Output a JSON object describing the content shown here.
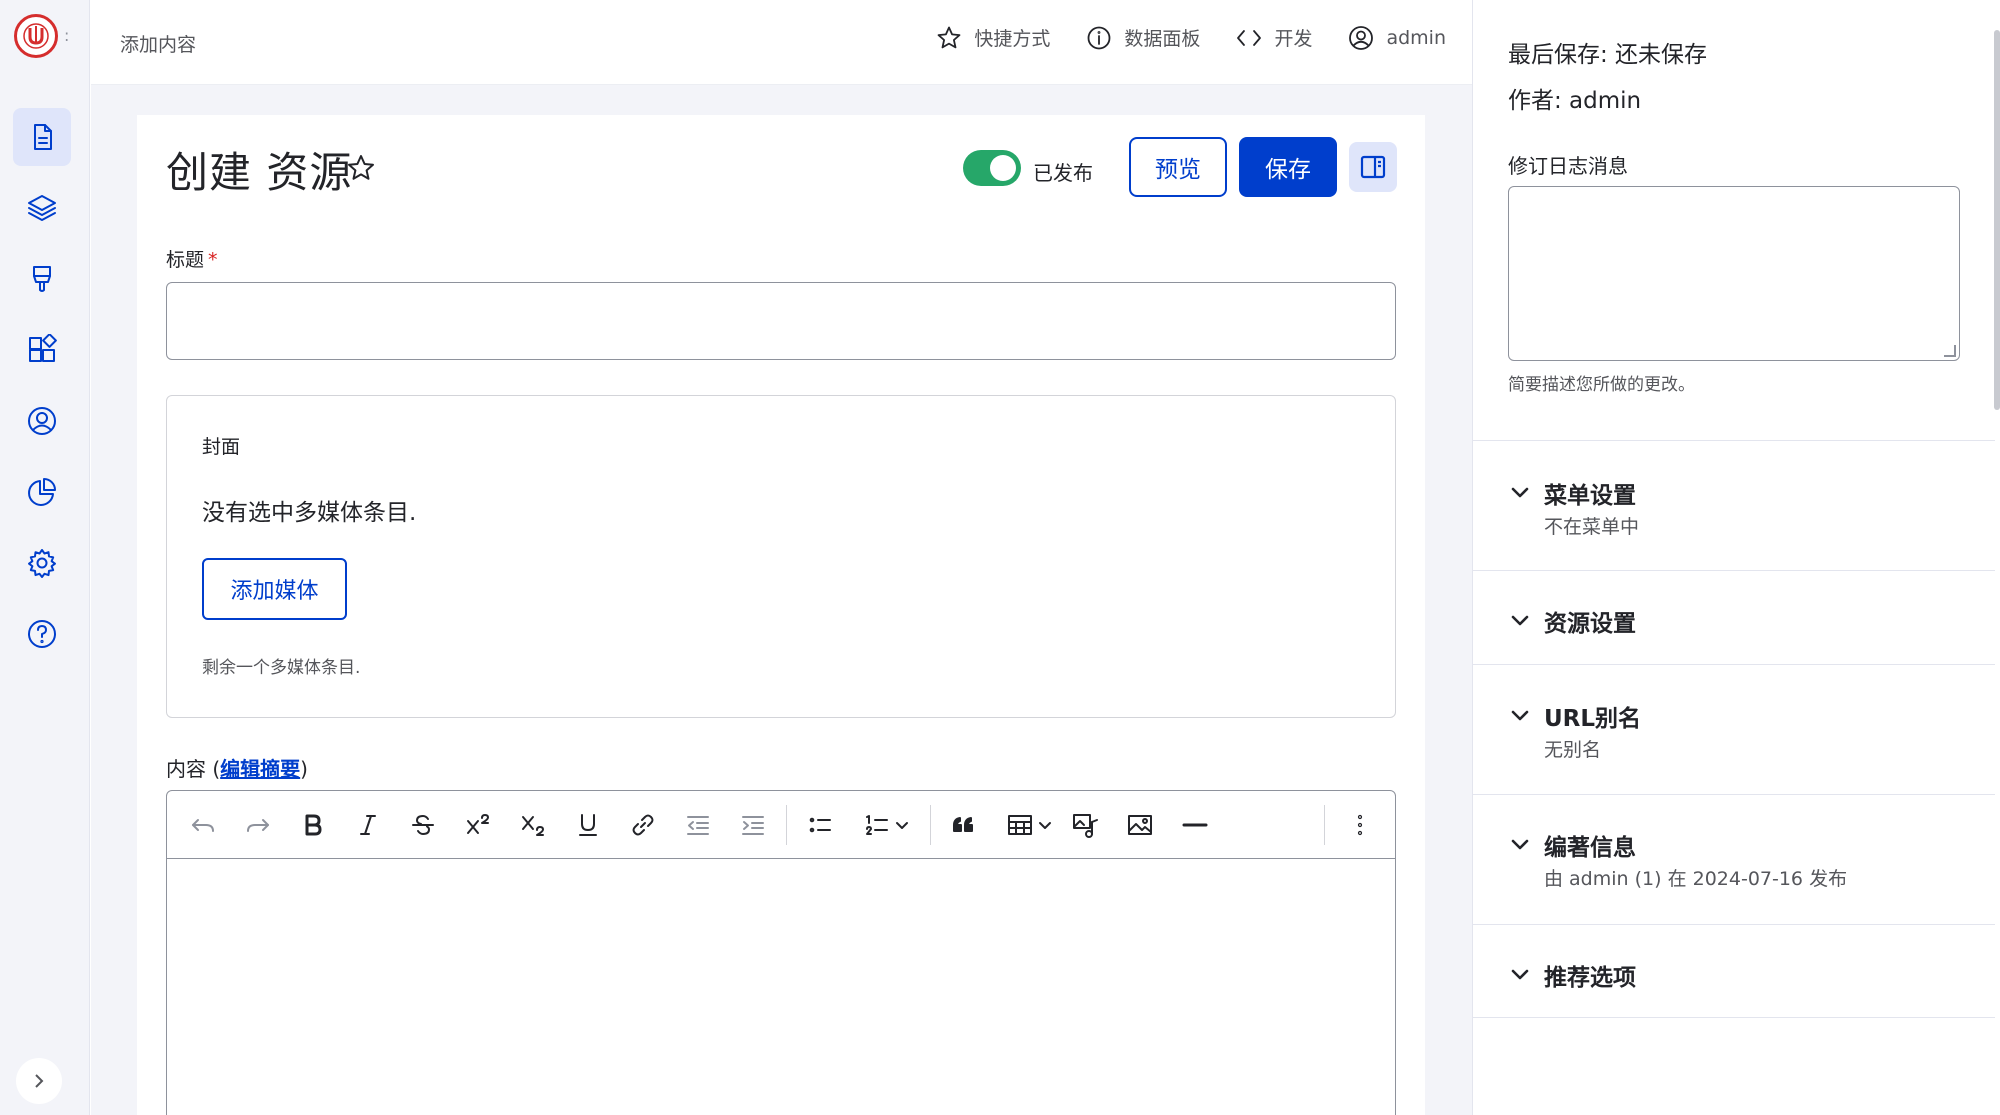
{
  "topbar": {
    "page_crumb": "添加内容",
    "links": [
      {
        "label": "快捷方式",
        "icon": "star-icon"
      },
      {
        "label": "数据面板",
        "icon": "info-icon"
      },
      {
        "label": "开发",
        "icon": "code-icon"
      },
      {
        "label": "admin",
        "icon": "user-circle-icon"
      }
    ]
  },
  "rail": {
    "items": [
      {
        "name": "content",
        "icon": "file-icon",
        "active": true
      },
      {
        "name": "structure",
        "icon": "layers-icon"
      },
      {
        "name": "appearance",
        "icon": "brush-icon"
      },
      {
        "name": "extend",
        "icon": "puzzle-icon"
      },
      {
        "name": "people",
        "icon": "user-circle-icon"
      },
      {
        "name": "reports",
        "icon": "pie-chart-icon"
      },
      {
        "name": "config",
        "icon": "gear-icon"
      },
      {
        "name": "help",
        "icon": "help-icon"
      }
    ]
  },
  "header": {
    "title": "创建 资源",
    "published_label": "已发布",
    "published": true,
    "preview_label": "预览",
    "save_label": "保存"
  },
  "form": {
    "title_label": "标题",
    "required_mark": "*",
    "title_value": "",
    "media": {
      "title": "封面",
      "empty_text": "没有选中多媒体条目.",
      "add_button": "添加媒体",
      "remaining_text": "剩余一个多媒体条目."
    },
    "content_label_prefix": "内容 (",
    "content_label_link": "编辑摘要",
    "content_label_suffix": ")"
  },
  "editor": {
    "toolbar": [
      "undo",
      "redo",
      "bold",
      "italic",
      "strikethrough",
      "superscript",
      "subscript",
      "underline",
      "link",
      "outdent",
      "indent",
      "bulleted-list",
      "numbered-list",
      "blockquote",
      "table",
      "media-embed",
      "image",
      "horizontal-line",
      "more"
    ]
  },
  "sidebar": {
    "last_saved": "最后保存: 还未保存",
    "author": "作者: admin",
    "revision_label": "修订日志消息",
    "revision_value": "",
    "revision_help": "简要描述您所做的更改。",
    "sections": [
      {
        "title": "菜单设置",
        "summary": "不在菜单中"
      },
      {
        "title": "资源设置",
        "summary": ""
      },
      {
        "title": "URL别名",
        "summary": "无别名"
      },
      {
        "title": "编著信息",
        "summary": "由 admin (1) 在 2024-07-16 发布"
      },
      {
        "title": "推荐选项",
        "summary": ""
      }
    ]
  },
  "colors": {
    "accent": "#003ecc",
    "toggle_on": "#26a769",
    "rail_bg": "#f3f4f9",
    "required": "#d72222"
  }
}
